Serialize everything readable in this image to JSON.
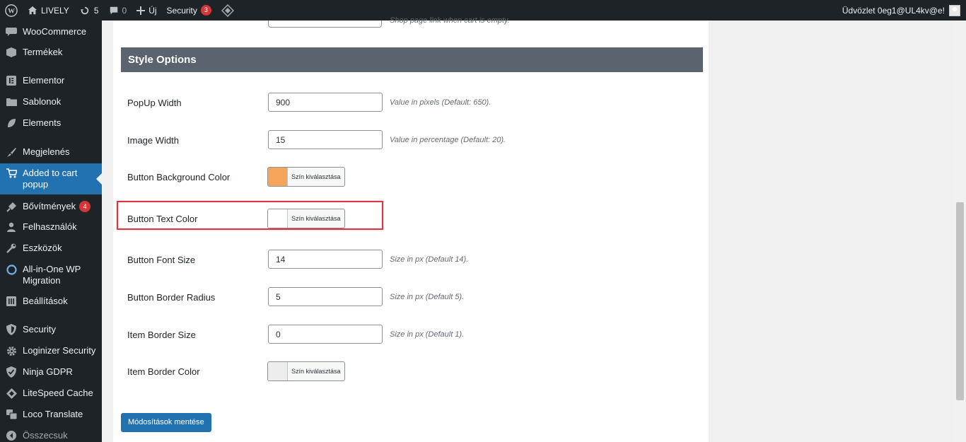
{
  "adminbar": {
    "site_name": "LIVELY",
    "updates_count": "5",
    "comments_count": "0",
    "new_label": "Új",
    "security_label": "Security",
    "security_badge": "3",
    "greeting": "Üdvözlet 0eg1@UL4kv@e!"
  },
  "sidebar": {
    "items": [
      {
        "label": "WooCommerce",
        "icon": "woo-icon"
      },
      {
        "label": "Termékek",
        "icon": "box-icon"
      },
      {
        "label": "Elementor",
        "icon": "elementor-icon"
      },
      {
        "label": "Sablonok",
        "icon": "folder-icon"
      },
      {
        "label": "Elements",
        "icon": "leaf-icon"
      },
      {
        "label": "Megjelenés",
        "icon": "brush-icon"
      },
      {
        "label": "Added to cart popup",
        "icon": "cart-icon"
      },
      {
        "label": "Bővítmények",
        "icon": "plugin-icon",
        "badge": "4"
      },
      {
        "label": "Felhasználók",
        "icon": "user-icon"
      },
      {
        "label": "Eszközök",
        "icon": "wrench-icon"
      },
      {
        "label": "All-in-One WP Migration",
        "icon": "migration-icon"
      },
      {
        "label": "Beállítások",
        "icon": "settings-icon"
      },
      {
        "label": "Security",
        "icon": "shield-icon"
      },
      {
        "label": "Loginizer Security",
        "icon": "gear-icon"
      },
      {
        "label": "Ninja GDPR",
        "icon": "shield-check-icon"
      },
      {
        "label": "LiteSpeed Cache",
        "icon": "diamond-icon"
      },
      {
        "label": "Loco Translate",
        "icon": "translate-icon"
      },
      {
        "label": "Összecsuk",
        "icon": "collapse-icon"
      }
    ]
  },
  "top_row": {
    "help": "Shop page link when cart is empty."
  },
  "section": {
    "title": "Style Options"
  },
  "fields": {
    "popup_width": {
      "label": "PopUp Width",
      "value": "900",
      "help": "Value in pixels (Default: 650)."
    },
    "image_width": {
      "label": "Image Width",
      "value": "15",
      "help": "Value in percentage (Default: 20)."
    },
    "button_bg_color": {
      "label": "Button Background Color",
      "button": "Szín kiválasztása",
      "color": "#f5a55a"
    },
    "button_text_color": {
      "label": "Button Text Color",
      "button": "Szín kiválasztása",
      "color": "#ffffff"
    },
    "button_font_size": {
      "label": "Button Font Size",
      "value": "14",
      "help": "Size in px (Default 14)."
    },
    "button_border_radius": {
      "label": "Button Border Radius",
      "value": "5",
      "help": "Size in px (Default 5)."
    },
    "item_border_size": {
      "label": "Item Border Size",
      "value": "0",
      "help": "Size in px (Default 1)."
    },
    "item_border_color": {
      "label": "Item Border Color",
      "button": "Szín kiválasztása",
      "color": "#ededed"
    }
  },
  "save_button": "Módosítások mentése",
  "colors": {
    "accent": "#2271b1",
    "highlight": "#d9363e",
    "section_head": "#5b636e"
  }
}
